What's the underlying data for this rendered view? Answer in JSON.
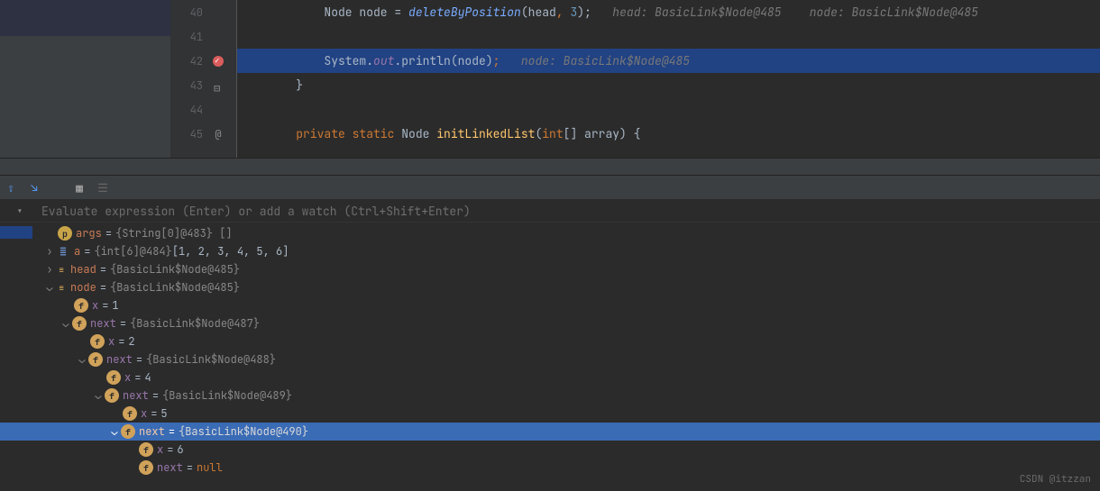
{
  "editor": {
    "lines": [
      {
        "n": "40",
        "icon": ""
      },
      {
        "n": "41",
        "icon": ""
      },
      {
        "n": "42",
        "icon": "breakpoint"
      },
      {
        "n": "43",
        "icon": "fold"
      },
      {
        "n": "44",
        "icon": ""
      },
      {
        "n": "45",
        "icon": "at"
      }
    ],
    "l40": {
      "indent": "        ",
      "t_node": "Node",
      "t_var": " node ",
      "t_eq": "= ",
      "t_call": "deleteByPosition",
      "t_open": "(",
      "t_arg1": "head",
      "t_comma": ", ",
      "t_arg2": "3",
      "t_close": ");",
      "t_pad1": "   ",
      "hint1": "head: BasicLink$Node@485",
      "t_pad2": "    ",
      "hint2": "node: BasicLink$Node@485"
    },
    "l42": {
      "indent": "        ",
      "t_sys": "System.",
      "t_out": "out",
      "t_dot": ".",
      "t_prn": "println(node)",
      "t_semi": ";",
      "t_pad": "   ",
      "hint": "node: BasicLink$Node@485"
    },
    "l43": {
      "indent": "    ",
      "brace": "}"
    },
    "l45": {
      "indent": "    ",
      "t_priv": "private ",
      "t_static": "static ",
      "t_type": "Node ",
      "t_name": "initLinkedList",
      "t_open": "(",
      "t_int": "int",
      "t_arr": "[] array) {"
    }
  },
  "watch": {
    "placeholder": "Evaluate expression (Enter) or add a watch (Ctrl+Shift+Enter)"
  },
  "vars": {
    "args_name": "args",
    "args_val": "{String[0]@483} []",
    "a_name": "a",
    "a_val": "{int[6]@484} ",
    "a_arr": "[1, 2, 3, 4, 5, 6]",
    "head_name": "head",
    "head_val": "{BasicLink$Node@485}",
    "node_name": "node",
    "node_val": "{BasicLink$Node@485}",
    "x_name": "x",
    "x1": "1",
    "next_name": "next",
    "next1_val": "{BasicLink$Node@487}",
    "x2": "2",
    "next2_val": "{BasicLink$Node@488}",
    "x4": "4",
    "next3_val": "{BasicLink$Node@489}",
    "x5": "5",
    "next4_val": "{BasicLink$Node@490}",
    "x6": "6",
    "null_val": "null",
    "eq": " = "
  },
  "watermark": "CSDN @itzzan"
}
